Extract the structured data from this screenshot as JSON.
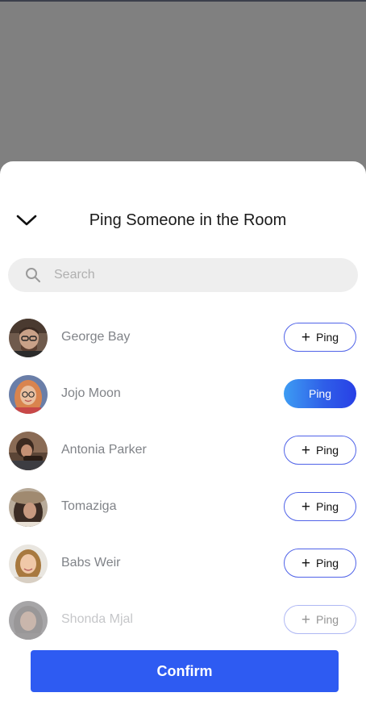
{
  "sheet": {
    "title": "Ping Someone in the Room",
    "collapse_icon": "chevron-down-icon"
  },
  "search": {
    "placeholder": "Search",
    "value": "",
    "icon": "search-icon"
  },
  "people": [
    {
      "name": "George Bay",
      "ping_label": "Ping",
      "pinged": false
    },
    {
      "name": "Jojo Moon",
      "ping_label": "Ping",
      "pinged": true
    },
    {
      "name": "Antonia Parker",
      "ping_label": "Ping",
      "pinged": false
    },
    {
      "name": "Tomaziga",
      "ping_label": "Ping",
      "pinged": false
    },
    {
      "name": "Babs Weir",
      "ping_label": "Ping",
      "pinged": false
    },
    {
      "name": "Shonda Mjal",
      "ping_label": "Ping",
      "pinged": false
    }
  ],
  "confirm_label": "Confirm",
  "colors": {
    "accent": "#2e5bf2",
    "ping_gradient_start": "#3d9cf3",
    "ping_border": "#5063e8",
    "backdrop": "#808080"
  }
}
